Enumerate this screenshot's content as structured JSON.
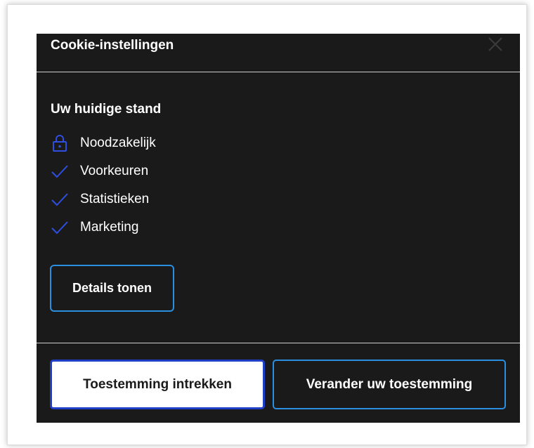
{
  "dialog": {
    "title": "Cookie-instellingen",
    "close_icon": "close-icon",
    "subtitle": "Uw huidige stand",
    "items": [
      {
        "label": "Noodzakelijk",
        "icon": "lock-icon"
      },
      {
        "label": "Voorkeuren",
        "icon": "checkmark-icon"
      },
      {
        "label": "Statistieken",
        "icon": "checkmark-icon"
      },
      {
        "label": "Marketing",
        "icon": "checkmark-icon"
      }
    ],
    "details_label": "Details tonen",
    "withdraw_label": "Toestemming intrekken",
    "change_label": "Verander uw toestemming"
  },
  "colors": {
    "background": "#1a1a1a",
    "accent_blue": "#1f3fc9",
    "button_border": "#2a8fe0",
    "text": "#ffffff"
  }
}
